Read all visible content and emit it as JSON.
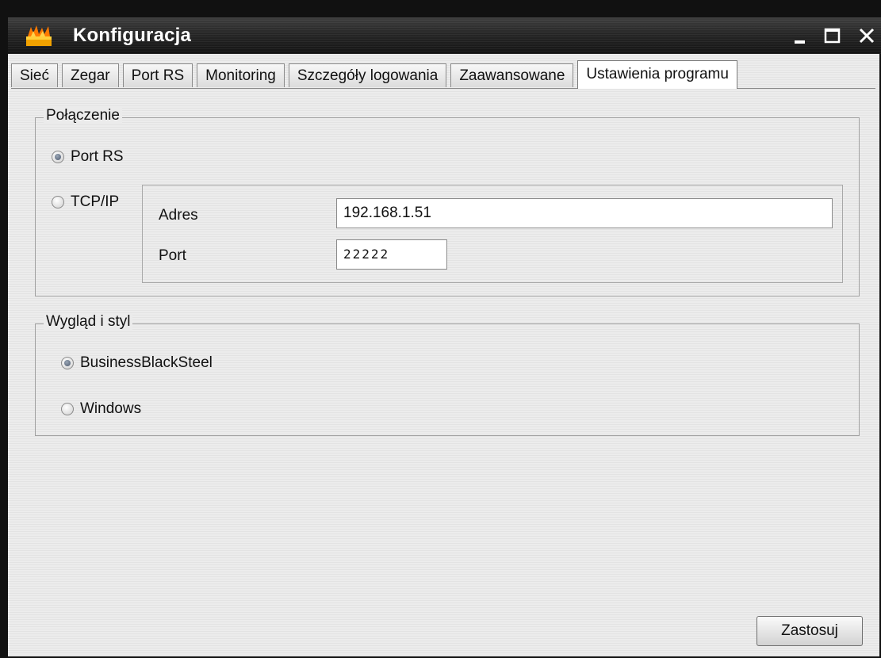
{
  "window": {
    "title": "Konfiguracja"
  },
  "tabs": [
    {
      "label": "Sieć"
    },
    {
      "label": "Zegar"
    },
    {
      "label": "Port RS"
    },
    {
      "label": "Monitoring"
    },
    {
      "label": "Szczegóły logowania"
    },
    {
      "label": "Zaawansowane"
    },
    {
      "label": "Ustawienia programu",
      "active": true
    }
  ],
  "connection": {
    "legend": "Połączenie",
    "option_rs": "Port RS",
    "option_tcp": "TCP/IP",
    "selected": "Port RS",
    "address_label": "Adres",
    "address_value": "192.168.1.51",
    "port_label": "Port",
    "port_value": "22222"
  },
  "appearance": {
    "legend": "Wygląd i styl",
    "option_business": "BusinessBlackSteel",
    "option_windows": "Windows",
    "selected": "BusinessBlackSteel"
  },
  "buttons": {
    "apply": "Zastosuj"
  },
  "icons": {
    "app": "flame-app-icon",
    "minimize": "minimize-icon",
    "maximize": "maximize-icon",
    "close": "close-icon"
  },
  "colors": {
    "titlebar": "#1e1e1e",
    "client_bg": "#ebebeb",
    "radio_selected": "#4c5a6e"
  }
}
